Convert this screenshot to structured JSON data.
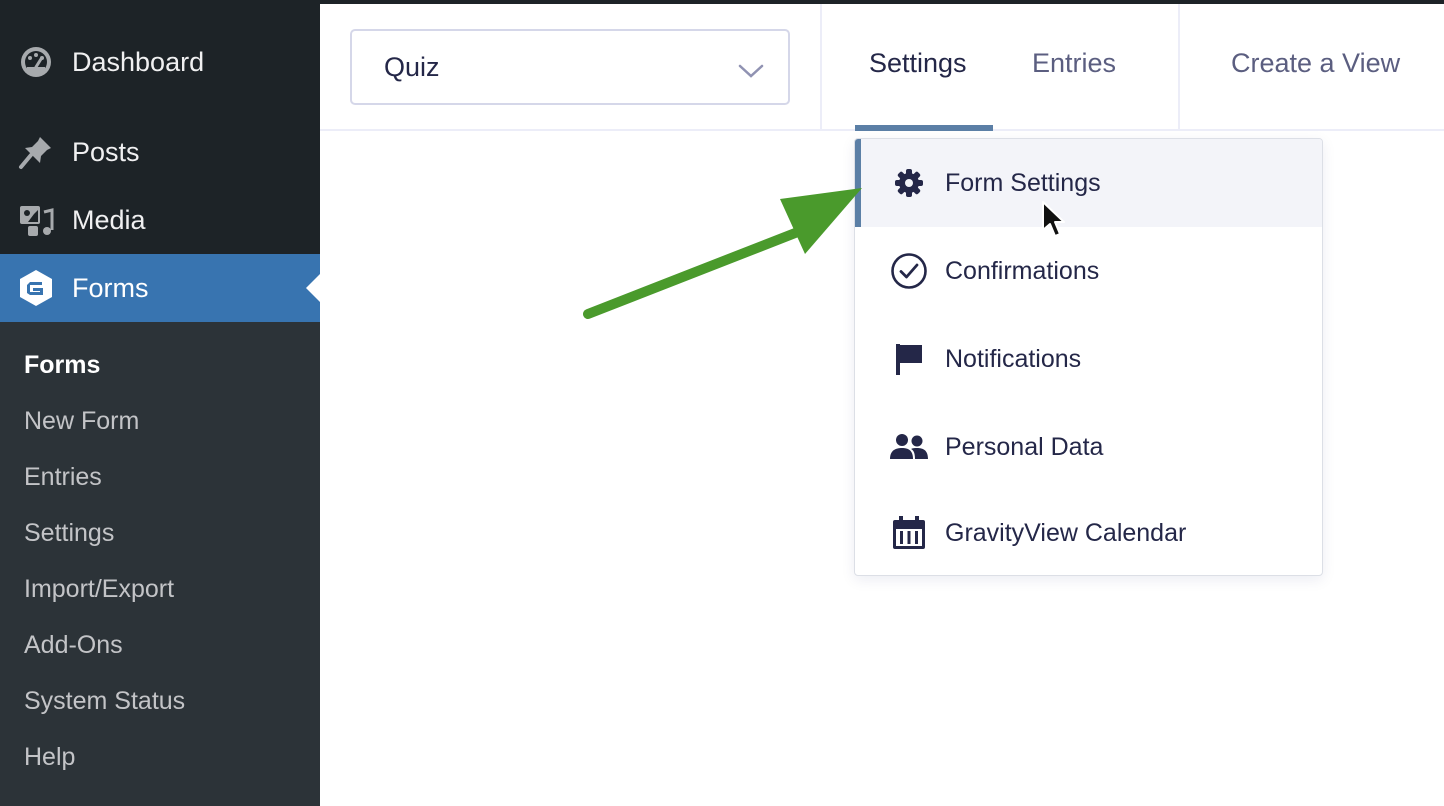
{
  "sidebar": {
    "menu": [
      {
        "label": "Dashboard",
        "icon": "dashboard-icon"
      },
      {
        "label": "Posts",
        "icon": "pin-icon"
      },
      {
        "label": "Media",
        "icon": "media-icon"
      },
      {
        "label": "Forms",
        "icon": "gravity-forms-icon",
        "current": true
      }
    ],
    "submenu": [
      {
        "label": "Forms",
        "current": true
      },
      {
        "label": "New Form"
      },
      {
        "label": "Entries"
      },
      {
        "label": "Settings"
      },
      {
        "label": "Import/Export"
      },
      {
        "label": "Add-Ons"
      },
      {
        "label": "System Status"
      },
      {
        "label": "Help"
      }
    ]
  },
  "header": {
    "form_select": {
      "value": "Quiz"
    },
    "tabs": [
      {
        "label": "Settings",
        "active": true
      },
      {
        "label": "Entries"
      },
      {
        "label": "Create a View"
      }
    ]
  },
  "dropdown": {
    "items": [
      {
        "label": "Form Settings",
        "icon": "gear-icon",
        "active": true
      },
      {
        "label": "Confirmations",
        "icon": "check-circle-icon"
      },
      {
        "label": "Notifications",
        "icon": "flag-icon"
      },
      {
        "label": "Personal Data",
        "icon": "users-icon"
      },
      {
        "label": "GravityView Calendar",
        "icon": "calendar-icon"
      }
    ]
  },
  "colors": {
    "sidebar_bg": "#1d2327",
    "submenu_bg": "#2c3338",
    "forms_highlight": "#3874b0",
    "tab_accent": "#5b7fa6",
    "annotation_arrow": "#4a9a2c",
    "text_dark": "#242748"
  }
}
